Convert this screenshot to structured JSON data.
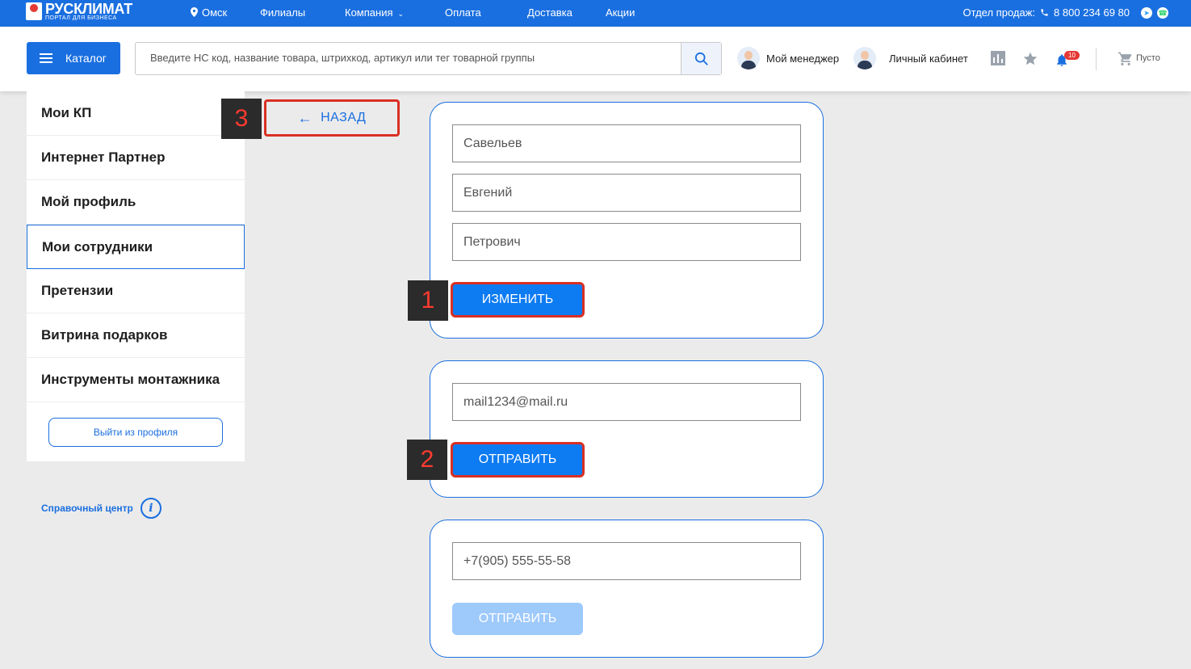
{
  "topbar": {
    "logo_title": "РУСКЛИМАТ",
    "logo_subtitle": "ПОРТАЛ ДЛЯ БИЗНЕСА",
    "city": "Омск",
    "nav": [
      "Филиалы",
      "Компания",
      "Оплата",
      "Доставка",
      "Акции"
    ],
    "sales_label": "Отдел продаж:",
    "phone": "8 800 234 69 80"
  },
  "header": {
    "catalog_label": "Каталог",
    "search_placeholder": "Введите НС код, название товара, штрихкод, артикул или тег товарной группы",
    "manager_label": "Мой менеджер",
    "cabinet_label": "Личный кабинет",
    "notifications_count": "10",
    "cart_label": "Пусто"
  },
  "sidebar": {
    "items": [
      {
        "label": "Мои КП"
      },
      {
        "label": "Интернет Партнер"
      },
      {
        "label": "Мой профиль"
      },
      {
        "label": "Мои сотрудники"
      },
      {
        "label": "Претензии"
      },
      {
        "label": "Витрина подарков"
      },
      {
        "label": "Инструменты монтажника"
      }
    ],
    "active_index": 3,
    "logout_label": "Выйти из профиля",
    "help_label": "Справочный центр"
  },
  "back_label": "НАЗАД",
  "markers": [
    "1",
    "2",
    "3"
  ],
  "name_card": {
    "last_name": "Савельев",
    "first_name": "Евгений",
    "patronymic": "Петрович",
    "button_label": "ИЗМЕНИТЬ"
  },
  "email_card": {
    "email": "mail1234@mail.ru",
    "button_label": "ОТПРАВИТЬ"
  },
  "phone_card": {
    "phone": "+7(905) 555-55-58",
    "button_label": "ОТПРАВИТЬ"
  },
  "colors": {
    "brand_blue": "#1a6fe0",
    "button_blue": "#0d7bf2",
    "disabled_blue": "#9ec9fb",
    "highlight_red": "#d93025"
  }
}
